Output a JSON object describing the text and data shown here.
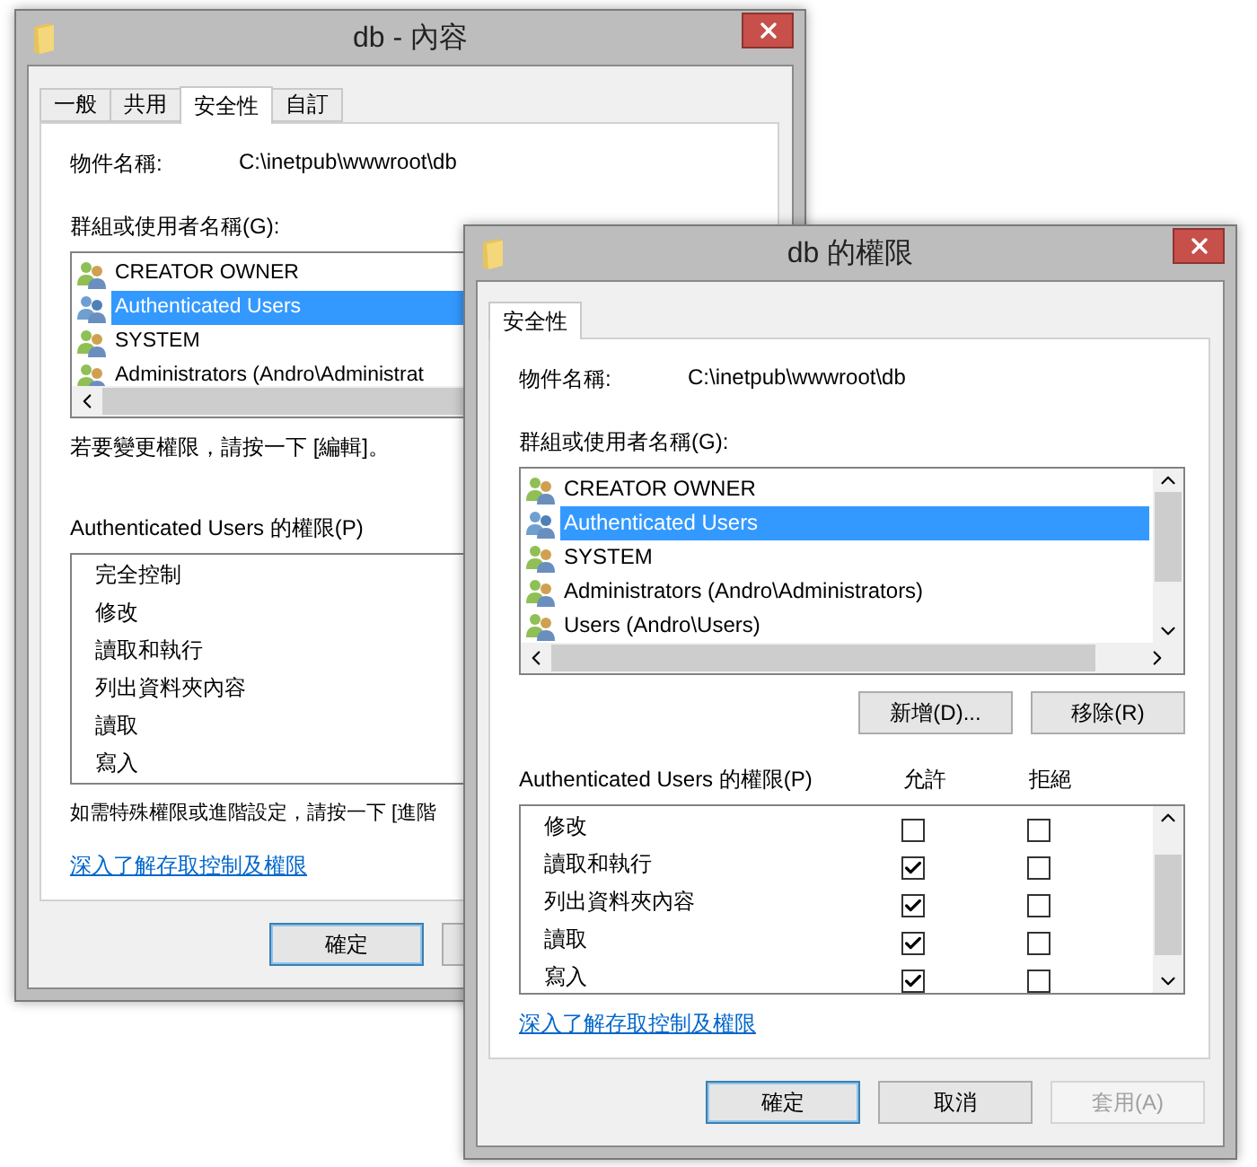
{
  "properties_window": {
    "title": "db - 內容",
    "tabs": [
      {
        "label": "一般",
        "selected": false
      },
      {
        "label": "共用",
        "selected": false
      },
      {
        "label": "安全性",
        "selected": true
      },
      {
        "label": "自訂",
        "selected": false
      }
    ],
    "object_label": "物件名稱:",
    "object_value": "C:\\inetpub\\wwwroot\\db",
    "groups_label": "群組或使用者名稱(G):",
    "groups": [
      {
        "name": "CREATOR OWNER",
        "kind": "group",
        "selected": false
      },
      {
        "name": "Authenticated Users",
        "kind": "special",
        "selected": true
      },
      {
        "name": "SYSTEM",
        "kind": "group",
        "selected": false
      },
      {
        "name": "Administrators (Andro\\Administrat",
        "kind": "group",
        "selected": false
      }
    ],
    "edit_hint": "若要變更權限，請按一下 [編輯]。",
    "permissions_label": "Authenticated Users 的權限(P)",
    "permissions": [
      "完全控制",
      "修改",
      "讀取和執行",
      "列出資料夾內容",
      "讀取",
      "寫入"
    ],
    "advanced_hint": "如需特殊權限或進階設定，請按一下 [進階",
    "link": "深入了解存取控制及權限",
    "buttons": [
      {
        "label": "確定",
        "default": true
      }
    ]
  },
  "permissions_window": {
    "title": "db 的權限",
    "tabs": [
      {
        "label": "安全性",
        "selected": true
      }
    ],
    "object_label": "物件名稱:",
    "object_value": "C:\\inetpub\\wwwroot\\db",
    "groups_label": "群組或使用者名稱(G):",
    "groups": [
      {
        "name": "CREATOR OWNER",
        "kind": "group",
        "selected": false
      },
      {
        "name": "Authenticated Users",
        "kind": "special",
        "selected": true
      },
      {
        "name": "SYSTEM",
        "kind": "group",
        "selected": false
      },
      {
        "name": "Administrators (Andro\\Administrators)",
        "kind": "group",
        "selected": false
      },
      {
        "name": "Users (Andro\\Users)",
        "kind": "group",
        "selected": false
      }
    ],
    "list_buttons": [
      {
        "label": "新增(D)..."
      },
      {
        "label": "移除(R)"
      }
    ],
    "permissions_label": "Authenticated Users 的權限(P)",
    "allow_label": "允許",
    "deny_label": "拒絕",
    "permissions": [
      {
        "name": "修改",
        "allow": false,
        "deny": false
      },
      {
        "name": "讀取和執行",
        "allow": true,
        "deny": false
      },
      {
        "name": "列出資料夾內容",
        "allow": true,
        "deny": false
      },
      {
        "name": "讀取",
        "allow": true,
        "deny": false
      },
      {
        "name": "寫入",
        "allow": true,
        "deny": false
      }
    ],
    "link": "深入了解存取控制及權限",
    "buttons": [
      {
        "label": "確定",
        "default": true,
        "disabled": false
      },
      {
        "label": "取消",
        "default": false,
        "disabled": false
      },
      {
        "label": "套用(A)",
        "default": false,
        "disabled": true
      }
    ]
  }
}
